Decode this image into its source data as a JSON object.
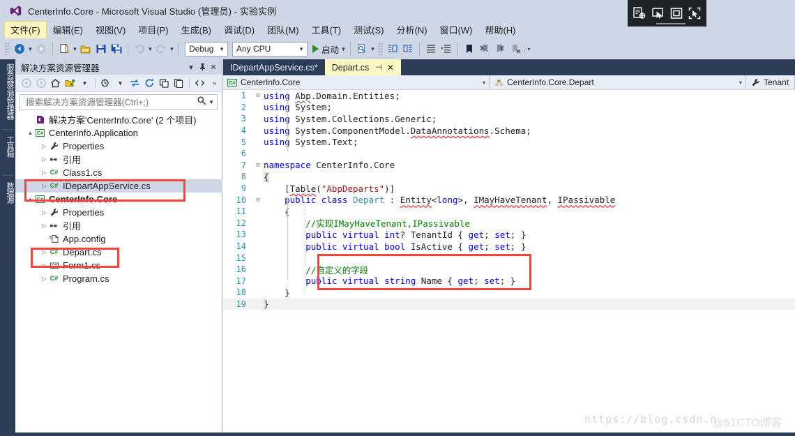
{
  "window": {
    "title": "CenterInfo.Core - Microsoft Visual Studio (管理员) - 实验实例",
    "logo_icon": "visual-studio-logo-icon"
  },
  "menubar": {
    "items": [
      {
        "label": "文件(F)",
        "active": true
      },
      {
        "label": "编辑(E)",
        "active": false
      },
      {
        "label": "视图(V)",
        "active": false
      },
      {
        "label": "项目(P)",
        "active": false
      },
      {
        "label": "生成(B)",
        "active": false
      },
      {
        "label": "调试(D)",
        "active": false
      },
      {
        "label": "团队(M)",
        "active": false
      },
      {
        "label": "工具(T)",
        "active": false
      },
      {
        "label": "测试(S)",
        "active": false
      },
      {
        "label": "分析(N)",
        "active": false
      },
      {
        "label": "窗口(W)",
        "active": false
      },
      {
        "label": "帮助(H)",
        "active": false
      }
    ]
  },
  "toolbar": {
    "navigate_back_icon": "navigate-back-icon",
    "navigate_forward_icon": "navigate-forward-icon",
    "new_item_icon": "new-item-icon",
    "open_file_icon": "open-file-icon",
    "save_icon": "save-icon",
    "save_all_icon": "save-all-icon",
    "undo_icon": "undo-icon",
    "redo_icon": "redo-icon",
    "config_value": "Debug",
    "platform_value": "Any CPU",
    "start_label": "启动",
    "start_icon": "play-icon",
    "find_icon": "find-in-files-icon",
    "comment_icon": "comment-selection-icon",
    "uncomment_icon": "uncomment-selection-icon",
    "indent_icon": "increase-indent-icon",
    "outdent_icon": "decrease-indent-icon",
    "bookmark_icon": "bookmark-icon",
    "prev_bookmark_icon": "previous-bookmark-icon",
    "next_bookmark_icon": "next-bookmark-icon",
    "clear_bookmark_icon": "clear-bookmarks-icon",
    "overflow_icon": "toolbar-overflow-icon"
  },
  "left_rail": {
    "tabs": [
      {
        "label": "服务器资源管理器"
      },
      {
        "label": "工具箱"
      },
      {
        "label": "数据源"
      }
    ]
  },
  "solution_explorer": {
    "title": "解决方案资源管理器",
    "header_buttons": [
      {
        "icon": "chevron-down-icon",
        "glyph": "▾"
      },
      {
        "icon": "pin-icon",
        "glyph": "⊥"
      },
      {
        "icon": "close-icon",
        "glyph": "✕"
      }
    ],
    "toolbar_icons": [
      "back-icon",
      "forward-icon",
      "home-icon",
      "solution-views-icon",
      "pending-changes-icon",
      "sync-with-active-document-icon",
      "refresh-icon",
      "collapse-all-icon",
      "show-all-files-icon",
      "properties-code-icon",
      "overflow-icon"
    ],
    "search_placeholder": "搜索解决方案资源管理器(Ctrl+;)",
    "search_icon": "search-icon",
    "search_dropdown_icon": "chevron-down-icon",
    "tree": [
      {
        "label": "解决方案'CenterInfo.Core' (2 个项目)",
        "indent": 0,
        "arrow": "",
        "icon": "solution-icon",
        "bold": false,
        "selected": false
      },
      {
        "label": "CenterInfo.Application",
        "indent": 1,
        "arrow": "▲",
        "icon": "csharp-project-icon",
        "bold": false,
        "selected": false
      },
      {
        "label": "Properties",
        "indent": 2,
        "arrow": "▷",
        "icon": "wrench-icon",
        "bold": false,
        "selected": false
      },
      {
        "label": "引用",
        "indent": 2,
        "arrow": "▷",
        "icon": "references-icon",
        "bold": false,
        "selected": false
      },
      {
        "label": "Class1.cs",
        "indent": 2,
        "arrow": "▷",
        "icon": "csharp-file-icon",
        "bold": false,
        "selected": false
      },
      {
        "label": "IDepartAppService.cs",
        "indent": 2,
        "arrow": "▷",
        "icon": "csharp-file-icon",
        "bold": false,
        "selected": true
      },
      {
        "label": "CenterInfo.Core",
        "indent": 1,
        "arrow": "▲",
        "icon": "csharp-project-icon",
        "bold": true,
        "selected": false
      },
      {
        "label": "Properties",
        "indent": 2,
        "arrow": "▷",
        "icon": "wrench-icon",
        "bold": false,
        "selected": false
      },
      {
        "label": "引用",
        "indent": 2,
        "arrow": "▷",
        "icon": "references-icon",
        "bold": false,
        "selected": false
      },
      {
        "label": "App.config",
        "indent": 2,
        "arrow": "",
        "icon": "config-file-icon",
        "bold": false,
        "selected": false
      },
      {
        "label": "Depart.cs",
        "indent": 2,
        "arrow": "▷",
        "icon": "csharp-file-icon",
        "bold": false,
        "selected": false
      },
      {
        "label": "Form1.cs",
        "indent": 2,
        "arrow": "▷",
        "icon": "winform-file-icon",
        "bold": false,
        "selected": false
      },
      {
        "label": "Program.cs",
        "indent": 2,
        "arrow": "▷",
        "icon": "csharp-file-icon",
        "bold": false,
        "selected": false
      }
    ]
  },
  "editor": {
    "tabs": [
      {
        "label": "IDepartAppService.cs*",
        "active": false,
        "pin": "",
        "close": ""
      },
      {
        "label": "Depart.cs",
        "active": true,
        "pin": "⊣",
        "close": "✕"
      }
    ],
    "navbar": [
      {
        "icon": "csharp-project-icon",
        "label": "CenterInfo.Core",
        "arrow": "▾"
      },
      {
        "icon": "class-icon",
        "label": "CenterInfo.Core.Depart",
        "arrow": "▾"
      },
      {
        "icon": "property-icon",
        "label": "Tenant",
        "arrow": ""
      }
    ],
    "lines": [
      {
        "n": 1,
        "fold": "−",
        "indent": 0
      },
      {
        "n": 2,
        "fold": "",
        "indent": 0
      },
      {
        "n": 3,
        "fold": "",
        "indent": 0
      },
      {
        "n": 4,
        "fold": "",
        "indent": 0
      },
      {
        "n": 5,
        "fold": "",
        "indent": 0
      },
      {
        "n": 6,
        "fold": "",
        "indent": 0
      },
      {
        "n": 7,
        "fold": "−",
        "indent": 0
      },
      {
        "n": 8,
        "fold": "",
        "indent": 0
      },
      {
        "n": 9,
        "fold": "",
        "indent": 0
      },
      {
        "n": 10,
        "fold": "−",
        "indent": 0
      },
      {
        "n": 11,
        "fold": "",
        "indent": 0
      },
      {
        "n": 12,
        "fold": "",
        "indent": 0
      },
      {
        "n": 13,
        "fold": "",
        "indent": 0
      },
      {
        "n": 14,
        "fold": "",
        "indent": 0
      },
      {
        "n": 15,
        "fold": "",
        "indent": 0
      },
      {
        "n": 16,
        "fold": "",
        "indent": 0
      },
      {
        "n": 17,
        "fold": "",
        "indent": 0
      },
      {
        "n": 18,
        "fold": "",
        "indent": 0
      },
      {
        "n": 19,
        "fold": "",
        "indent": 0
      }
    ],
    "code_text": [
      "using Abp.Domain.Entities;",
      "using System;",
      "using System.Collections.Generic;",
      "using System.ComponentModel.DataAnnotations.Schema;",
      "using System.Text;",
      "",
      "namespace CenterInfo.Core",
      "{",
      "    [Table(\"AbpDeparts\")]",
      "    public class Depart : Entity<long>, IMayHaveTenant, IPassivable",
      "    {",
      "        //实现IMayHaveTenant,IPassivable",
      "        public virtual int? TenantId { get; set; }",
      "        public virtual bool IsActive { get; set; }",
      "",
      "        //自定义的字段",
      "        public virtual string Name { get; set; }",
      "    }",
      "}"
    ]
  },
  "capture_overlay": {
    "buttons": [
      {
        "icon": "capture-region-icon"
      },
      {
        "icon": "capture-cursor-icon"
      },
      {
        "icon": "capture-window-icon"
      },
      {
        "icon": "capture-fullscreen-icon"
      }
    ]
  },
  "watermarks": {
    "csdn": "https://blog.csdn.n",
    "cto": "@51CTO博客"
  },
  "colors": {
    "chrome": "#cfd6e6",
    "rail": "#2d3c56",
    "tab_active": "#fff8c4",
    "annotation_red": "#f4443b",
    "keyword": "#0000ff",
    "type": "#2b91af",
    "string": "#a31515",
    "comment": "#008000",
    "linenumber": "#2b91af"
  }
}
